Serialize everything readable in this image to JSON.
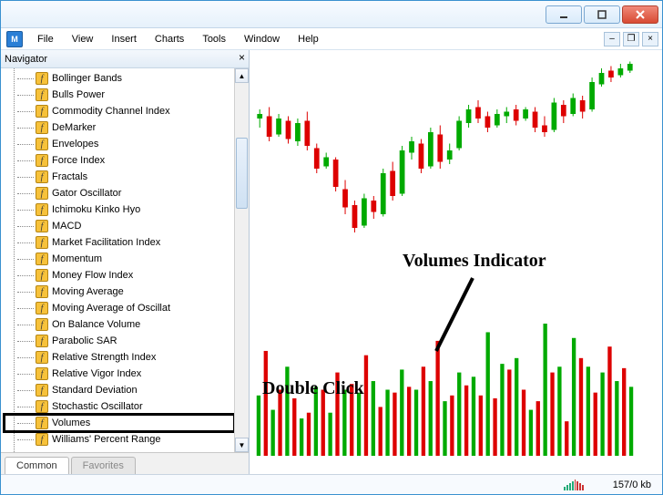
{
  "window": {
    "minimize_tip": "Minimize",
    "maximize_tip": "Maximize",
    "close_tip": "Close"
  },
  "menu": {
    "file": "File",
    "view": "View",
    "insert": "Insert",
    "charts": "Charts",
    "tools": "Tools",
    "window": "Window",
    "help": "Help"
  },
  "mdi": {
    "min": "–",
    "restore": "❐",
    "close": "×"
  },
  "navigator": {
    "title": "Navigator",
    "close": "×",
    "items": [
      "Bollinger Bands",
      "Bulls Power",
      "Commodity Channel Index",
      "DeMarker",
      "Envelopes",
      "Force Index",
      "Fractals",
      "Gator Oscillator",
      "Ichimoku Kinko Hyo",
      "MACD",
      "Market Facilitation Index",
      "Momentum",
      "Money Flow Index",
      "Moving Average",
      "Moving Average of Oscillat",
      "On Balance Volume",
      "Parabolic SAR",
      "Relative Strength Index",
      "Relative Vigor Index",
      "Standard Deviation",
      "Stochastic Oscillator",
      "Volumes",
      "Williams' Percent Range"
    ],
    "highlight_index": 21,
    "tabs": {
      "common": "Common",
      "favorites": "Favorites"
    }
  },
  "annotations": {
    "volumes_indicator": "Volumes Indicator",
    "double_click": "Double Click"
  },
  "status": {
    "bandwidth": "157/0 kb"
  },
  "chart_data": {
    "type": "candlestick+volume",
    "price_range": [
      0,
      100
    ],
    "candles": [
      {
        "o": 74,
        "h": 78,
        "l": 70,
        "c": 76,
        "dir": "up"
      },
      {
        "o": 75,
        "h": 79,
        "l": 64,
        "c": 66,
        "dir": "down"
      },
      {
        "o": 67,
        "h": 76,
        "l": 66,
        "c": 74,
        "dir": "up"
      },
      {
        "o": 73,
        "h": 75,
        "l": 63,
        "c": 65,
        "dir": "down"
      },
      {
        "o": 64,
        "h": 74,
        "l": 62,
        "c": 72,
        "dir": "up"
      },
      {
        "o": 73,
        "h": 77,
        "l": 60,
        "c": 62,
        "dir": "down"
      },
      {
        "o": 61,
        "h": 63,
        "l": 50,
        "c": 52,
        "dir": "down"
      },
      {
        "o": 53,
        "h": 59,
        "l": 52,
        "c": 57,
        "dir": "up"
      },
      {
        "o": 56,
        "h": 57,
        "l": 42,
        "c": 44,
        "dir": "down"
      },
      {
        "o": 43,
        "h": 47,
        "l": 32,
        "c": 35,
        "dir": "down"
      },
      {
        "o": 36,
        "h": 38,
        "l": 24,
        "c": 26,
        "dir": "down"
      },
      {
        "o": 27,
        "h": 41,
        "l": 26,
        "c": 39,
        "dir": "up"
      },
      {
        "o": 38,
        "h": 40,
        "l": 30,
        "c": 33,
        "dir": "down"
      },
      {
        "o": 32,
        "h": 52,
        "l": 31,
        "c": 50,
        "dir": "up"
      },
      {
        "o": 51,
        "h": 55,
        "l": 38,
        "c": 40,
        "dir": "down"
      },
      {
        "o": 41,
        "h": 62,
        "l": 40,
        "c": 60,
        "dir": "up"
      },
      {
        "o": 59,
        "h": 66,
        "l": 56,
        "c": 64,
        "dir": "up"
      },
      {
        "o": 63,
        "h": 65,
        "l": 50,
        "c": 52,
        "dir": "down"
      },
      {
        "o": 53,
        "h": 70,
        "l": 52,
        "c": 68,
        "dir": "up"
      },
      {
        "o": 67,
        "h": 71,
        "l": 52,
        "c": 55,
        "dir": "down"
      },
      {
        "o": 56,
        "h": 63,
        "l": 54,
        "c": 60,
        "dir": "up"
      },
      {
        "o": 61,
        "h": 75,
        "l": 60,
        "c": 73,
        "dir": "up"
      },
      {
        "o": 72,
        "h": 80,
        "l": 70,
        "c": 78,
        "dir": "up"
      },
      {
        "o": 79,
        "h": 82,
        "l": 72,
        "c": 74,
        "dir": "down"
      },
      {
        "o": 75,
        "h": 77,
        "l": 68,
        "c": 70,
        "dir": "down"
      },
      {
        "o": 71,
        "h": 78,
        "l": 70,
        "c": 76,
        "dir": "up"
      },
      {
        "o": 75,
        "h": 79,
        "l": 72,
        "c": 77,
        "dir": "up"
      },
      {
        "o": 78,
        "h": 80,
        "l": 71,
        "c": 73,
        "dir": "down"
      },
      {
        "o": 74,
        "h": 79,
        "l": 73,
        "c": 78,
        "dir": "up"
      },
      {
        "o": 77,
        "h": 79,
        "l": 68,
        "c": 70,
        "dir": "down"
      },
      {
        "o": 71,
        "h": 75,
        "l": 66,
        "c": 68,
        "dir": "down"
      },
      {
        "o": 69,
        "h": 83,
        "l": 68,
        "c": 81,
        "dir": "up"
      },
      {
        "o": 80,
        "h": 82,
        "l": 72,
        "c": 75,
        "dir": "down"
      },
      {
        "o": 76,
        "h": 85,
        "l": 75,
        "c": 83,
        "dir": "up"
      },
      {
        "o": 82,
        "h": 84,
        "l": 74,
        "c": 77,
        "dir": "down"
      },
      {
        "o": 78,
        "h": 92,
        "l": 77,
        "c": 90,
        "dir": "up"
      },
      {
        "o": 89,
        "h": 96,
        "l": 88,
        "c": 94,
        "dir": "up"
      },
      {
        "o": 95,
        "h": 97,
        "l": 90,
        "c": 92,
        "dir": "down"
      },
      {
        "o": 93,
        "h": 98,
        "l": 92,
        "c": 96,
        "dir": "up"
      },
      {
        "o": 95,
        "h": 99,
        "l": 94,
        "c": 98,
        "dir": "up"
      }
    ],
    "volumes": [
      42,
      73,
      32,
      46,
      62,
      40,
      26,
      30,
      48,
      46,
      30,
      58,
      46,
      50,
      44,
      70,
      52,
      34,
      46,
      44,
      60,
      48,
      46,
      62,
      52,
      80,
      38,
      42,
      58,
      49,
      55,
      42,
      86,
      40,
      64,
      60,
      68,
      46,
      32,
      38,
      92,
      58,
      62,
      24,
      82,
      68,
      62,
      44,
      58,
      76,
      52,
      61,
      48
    ]
  }
}
